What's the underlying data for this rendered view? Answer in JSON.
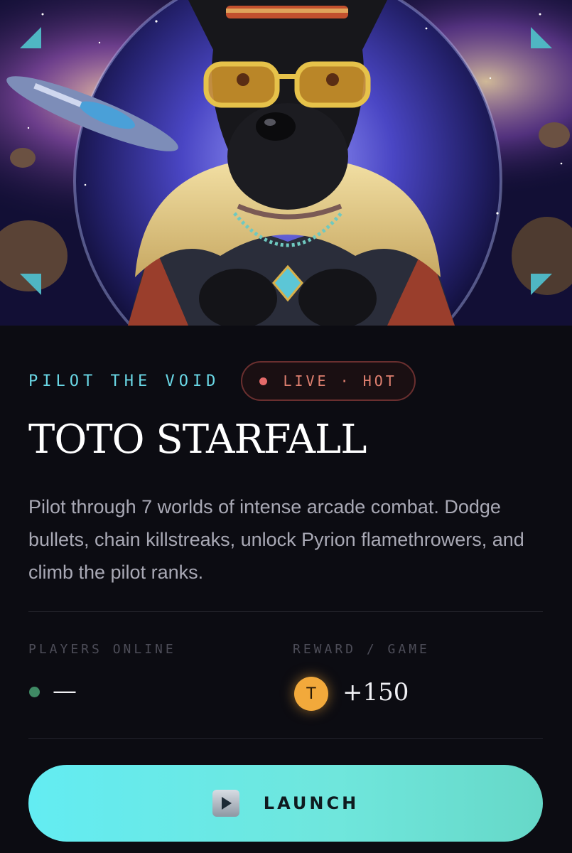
{
  "hero": {
    "image_alt": "Scottish terrier pilot in space with fur-collared jacket and gold sunglasses"
  },
  "card": {
    "eyebrow": "PILOT THE VOID",
    "status_badge": "LIVE · HOT",
    "title": "TOTO STARFALL",
    "description": "Pilot through 7 worlds of intense arcade combat. Dodge bullets, chain killstreaks, unlock Pyrion flamethrowers, and climb the pilot ranks.",
    "stats": {
      "players_label": "PLAYERS ONLINE",
      "players_value": "—",
      "reward_label": "REWARD / GAME",
      "reward_coin": "T",
      "reward_value": "+150"
    },
    "launch_label": "LAUNCH"
  },
  "icons": {
    "corners": "corner-bracket-icon",
    "live": "live-dot-icon",
    "players": "online-dot-icon",
    "coin": "token-coin-icon",
    "launch": "play-icon"
  },
  "colors": {
    "accent": "#6ad8e6",
    "live": "#e46a6a",
    "online": "#3f8a64",
    "coin": "#f2a93b",
    "button": "#63ecf2"
  }
}
